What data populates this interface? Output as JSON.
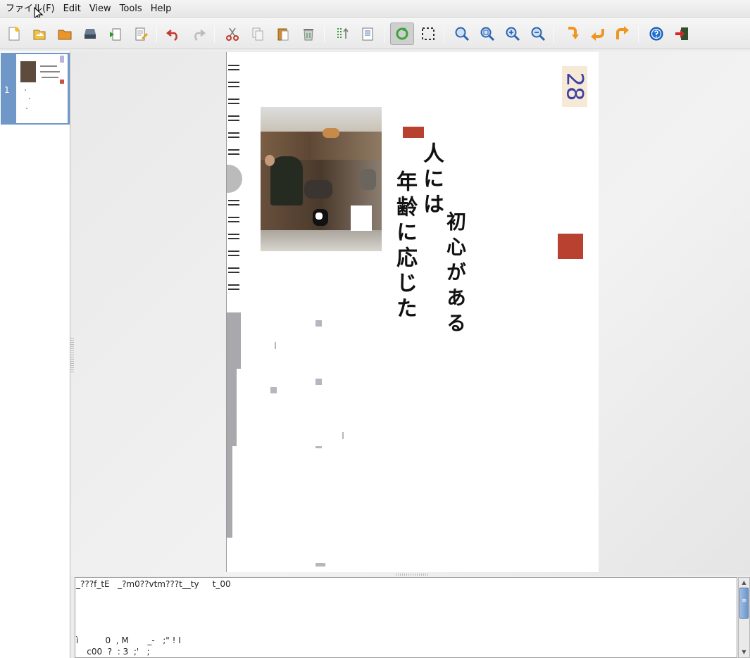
{
  "menubar": {
    "items": [
      {
        "label": "ファイル(F)"
      },
      {
        "label": "Edit"
      },
      {
        "label": "View"
      },
      {
        "label": "Tools"
      },
      {
        "label": "Help"
      }
    ]
  },
  "toolbar": {
    "buttons": [
      {
        "icon": "new-document-icon"
      },
      {
        "icon": "open-recent-icon"
      },
      {
        "icon": "open-folder-icon"
      },
      {
        "icon": "scan-icon"
      },
      {
        "icon": "import-image-icon"
      },
      {
        "icon": "edit-properties-icon"
      },
      {
        "icon": "undo-icon"
      },
      {
        "icon": "redo-icon"
      },
      {
        "icon": "cut-icon"
      },
      {
        "icon": "copy-icon"
      },
      {
        "icon": "paste-icon"
      },
      {
        "icon": "delete-icon"
      },
      {
        "icon": "recognize-layout-icon"
      },
      {
        "icon": "recognize-page-icon"
      },
      {
        "icon": "refresh-icon"
      },
      {
        "icon": "select-region-icon"
      },
      {
        "icon": "zoom-fit-icon"
      },
      {
        "icon": "zoom-original-icon"
      },
      {
        "icon": "zoom-in-icon"
      },
      {
        "icon": "zoom-out-icon"
      },
      {
        "icon": "rotate-down-icon"
      },
      {
        "icon": "rotate-left-icon"
      },
      {
        "icon": "rotate-right-icon"
      },
      {
        "icon": "help-icon"
      },
      {
        "icon": "exit-icon"
      }
    ]
  },
  "thumbnails": {
    "pages": [
      {
        "number": "1"
      }
    ]
  },
  "page": {
    "page_number": "28",
    "poem_lines": [
      "人には",
      "年齢に応じた",
      "初心がある"
    ]
  },
  "ocr_output": {
    "lines": [
      "_???f_tE   _?m0??vtm???t__ty     t_00",
      "ì          0  , M       _-   ;\" ! I",
      "    c00  ?  : 3  ;'   ;"
    ]
  },
  "colors": {
    "selection": "#6f97c8",
    "page_number_color": "#3b3fa3",
    "seal_red": "#b8412f"
  }
}
